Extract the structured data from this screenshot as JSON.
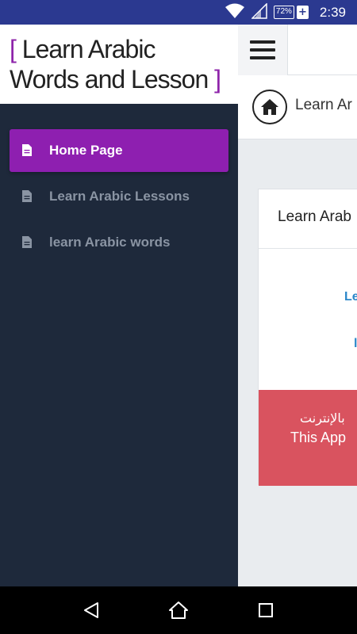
{
  "status_bar": {
    "battery": "72%",
    "time": "2:39"
  },
  "drawer": {
    "brand_line1": "Learn Arabic",
    "brand_line2": "Words and Lesson",
    "bracket_open": "[",
    "bracket_close": "]",
    "items": [
      {
        "label": "Home Page",
        "active": true
      },
      {
        "label": "Learn Arabic Lessons",
        "active": false
      },
      {
        "label": "learn Arabic words",
        "active": false
      }
    ]
  },
  "main": {
    "breadcrumb": "Learn Ar",
    "card_title": "Learn Arab",
    "link1": "Le",
    "link2": "l",
    "alert_arabic": "بالإنترنت",
    "alert_english": "This App"
  },
  "colors": {
    "accent": "#8e1fb0",
    "drawer_bg": "#1e293b",
    "status_bar": "#2b3990",
    "alert": "#d9535f",
    "link": "#2b87c9"
  },
  "icons": {
    "wifi": "wifi-icon",
    "signal": "signal-icon",
    "menu": "hamburger-menu-icon",
    "home": "home-icon",
    "file": "file-icon",
    "back": "back-icon",
    "home_nav": "home-nav-icon",
    "recents": "recents-icon"
  }
}
